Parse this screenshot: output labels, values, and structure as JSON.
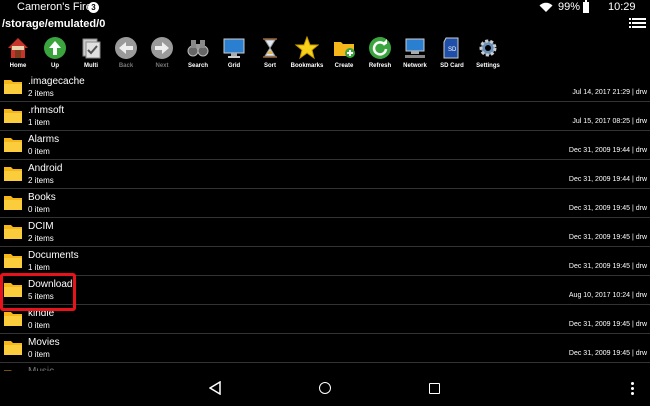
{
  "status_bar": {
    "title": "Cameron's Fire",
    "notification_count": "3",
    "battery_percent": "99%",
    "battery_level": 0.99,
    "time": "10:29"
  },
  "path": "/storage/emulated/0",
  "toolbar": [
    {
      "label": "Home",
      "icon": "home-icon",
      "enabled": true
    },
    {
      "label": "Up",
      "icon": "up-arrow-icon",
      "enabled": true
    },
    {
      "label": "Multi",
      "icon": "multi-select-icon",
      "enabled": true
    },
    {
      "label": "Back",
      "icon": "back-arrow-icon",
      "enabled": false
    },
    {
      "label": "Next",
      "icon": "next-arrow-icon",
      "enabled": false
    },
    {
      "label": "Search",
      "icon": "binoculars-icon",
      "enabled": true
    },
    {
      "label": "Grid",
      "icon": "grid-monitor-icon",
      "enabled": true
    },
    {
      "label": "Sort",
      "icon": "hourglass-icon",
      "enabled": true
    },
    {
      "label": "Bookmarks",
      "icon": "star-icon",
      "enabled": true
    },
    {
      "label": "Create",
      "icon": "create-folder-icon",
      "enabled": true
    },
    {
      "label": "Refresh",
      "icon": "refresh-icon",
      "enabled": true
    },
    {
      "label": "Network",
      "icon": "network-icon",
      "enabled": true
    },
    {
      "label": "SD Card",
      "icon": "sd-card-icon",
      "enabled": true
    },
    {
      "label": "Settings",
      "icon": "gear-icon",
      "enabled": true
    }
  ],
  "files": [
    {
      "name": ".imagecache",
      "count": "2 items",
      "meta": "Jul 14, 2017 21:29 | drw"
    },
    {
      "name": ".rhmsoft",
      "count": "1 item",
      "meta": "Jul 15, 2017 08:25 | drw"
    },
    {
      "name": "Alarms",
      "count": "0 item",
      "meta": "Dec 31, 2009 19:44 | drw"
    },
    {
      "name": "Android",
      "count": "2 items",
      "meta": "Dec 31, 2009 19:44 | drw"
    },
    {
      "name": "Books",
      "count": "0 item",
      "meta": "Dec 31, 2009 19:45 | drw"
    },
    {
      "name": "DCIM",
      "count": "2 items",
      "meta": "Dec 31, 2009 19:45 | drw"
    },
    {
      "name": "Documents",
      "count": "1 item",
      "meta": "Dec 31, 2009 19:45 | drw"
    },
    {
      "name": "Download",
      "count": "5 items",
      "meta": "Aug 10, 2017 10:24 | drw",
      "highlighted": true
    },
    {
      "name": "kindle",
      "count": "0 item",
      "meta": "Dec 31, 2009 19:45 | drw"
    },
    {
      "name": "Movies",
      "count": "0 item",
      "meta": "Dec 31, 2009 19:45 | drw"
    },
    {
      "name": "Music",
      "count": "",
      "meta": ""
    }
  ],
  "colors": {
    "background": "#000000",
    "folder": "#f5b71a",
    "highlight": "#e8121a"
  }
}
